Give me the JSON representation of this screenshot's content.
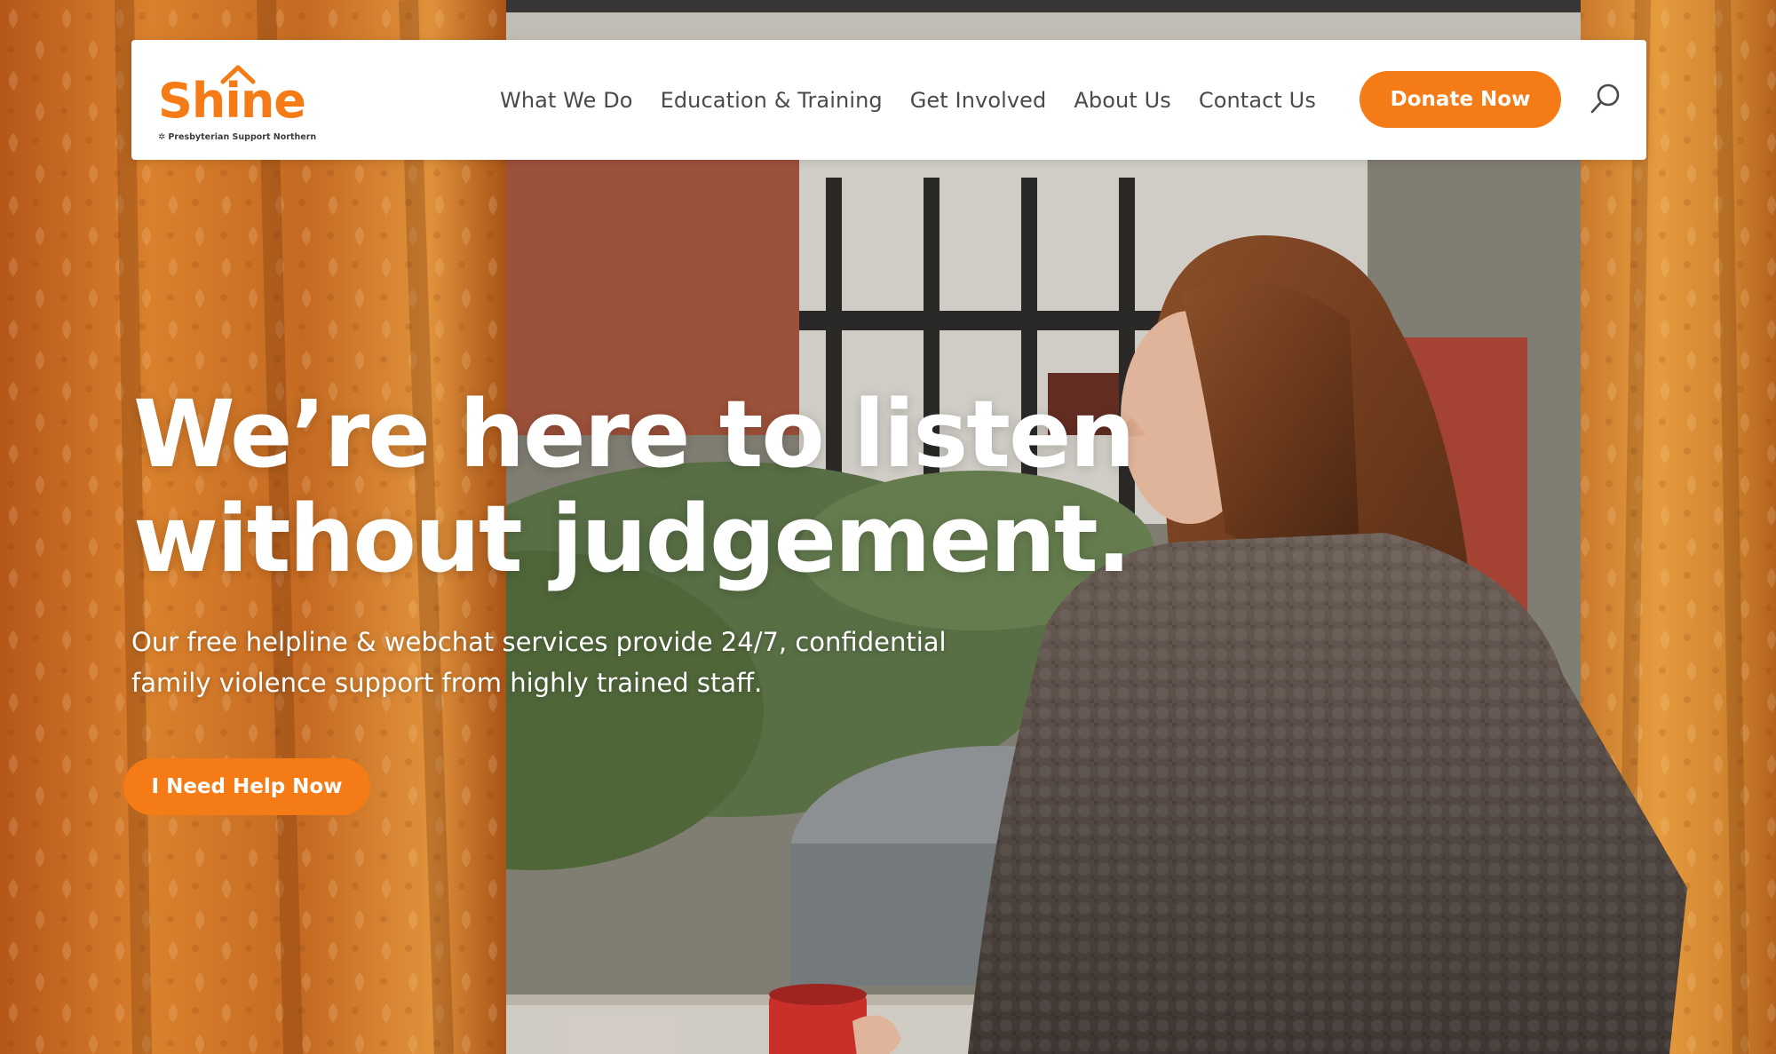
{
  "brand": {
    "name": "Shine",
    "tagline": "Presbyterian Support Northern",
    "accent_color": "#f47b16"
  },
  "nav": {
    "items": [
      {
        "label": "What We Do"
      },
      {
        "label": "Education & Training"
      },
      {
        "label": "Get Involved"
      },
      {
        "label": "About Us"
      },
      {
        "label": "Contact Us"
      }
    ],
    "donate_label": "Donate Now",
    "search_icon": "search-icon"
  },
  "hero": {
    "title_line1": "We’re here to listen",
    "title_line2": "without judgement.",
    "subtitle_line1": "Our free helpline & webchat services provide 24/7, confidential",
    "subtitle_line2": "family violence support from highly trained staff.",
    "cta_label": "I Need Help Now",
    "background_image": "woman-at-window-photo"
  }
}
